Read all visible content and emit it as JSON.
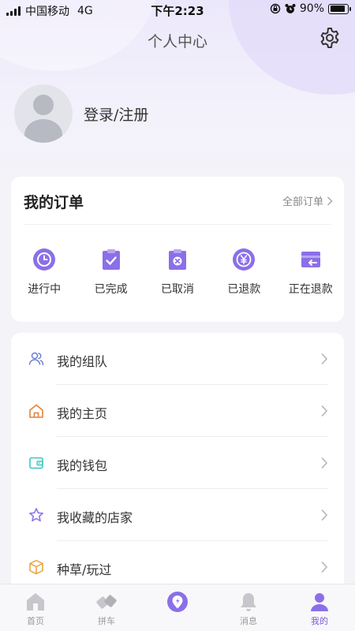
{
  "status_bar": {
    "carrier": "中国移动",
    "network": "4G",
    "time": "下午2:23",
    "battery": "90%",
    "battery_level": 0.9
  },
  "header": {
    "title": "个人中心",
    "settings_icon": "gear-icon"
  },
  "profile": {
    "login_label": "登录/注册"
  },
  "orders": {
    "title": "我的订单",
    "all_label": "全部订单",
    "items": [
      {
        "label": "进行中",
        "icon": "clock-icon"
      },
      {
        "label": "已完成",
        "icon": "clipboard-check-icon"
      },
      {
        "label": "已取消",
        "icon": "clipboard-cancel-icon"
      },
      {
        "label": "已退款",
        "icon": "yen-refund-icon"
      },
      {
        "label": "正在退款",
        "icon": "refund-return-icon"
      }
    ]
  },
  "menu": {
    "items": [
      {
        "label": "我的组队",
        "icon": "team-icon"
      },
      {
        "label": "我的主页",
        "icon": "home-icon"
      },
      {
        "label": "我的钱包",
        "icon": "wallet-icon"
      },
      {
        "label": "我收藏的店家",
        "icon": "star-icon"
      },
      {
        "label": "种草/玩过",
        "icon": "box-icon"
      }
    ]
  },
  "tabbar": {
    "items": [
      {
        "label": "首页",
        "icon": "home-tab-icon"
      },
      {
        "label": "拼车",
        "icon": "carpool-tab-icon"
      },
      {
        "label": "",
        "icon": "center-action-icon"
      },
      {
        "label": "消息",
        "icon": "bell-tab-icon"
      },
      {
        "label": "我的",
        "icon": "profile-tab-icon"
      }
    ],
    "active_index": 4
  },
  "colors": {
    "accent": "#8b6fe8",
    "accent_dark": "#7a5cdb",
    "background": "#f4f3f8"
  }
}
